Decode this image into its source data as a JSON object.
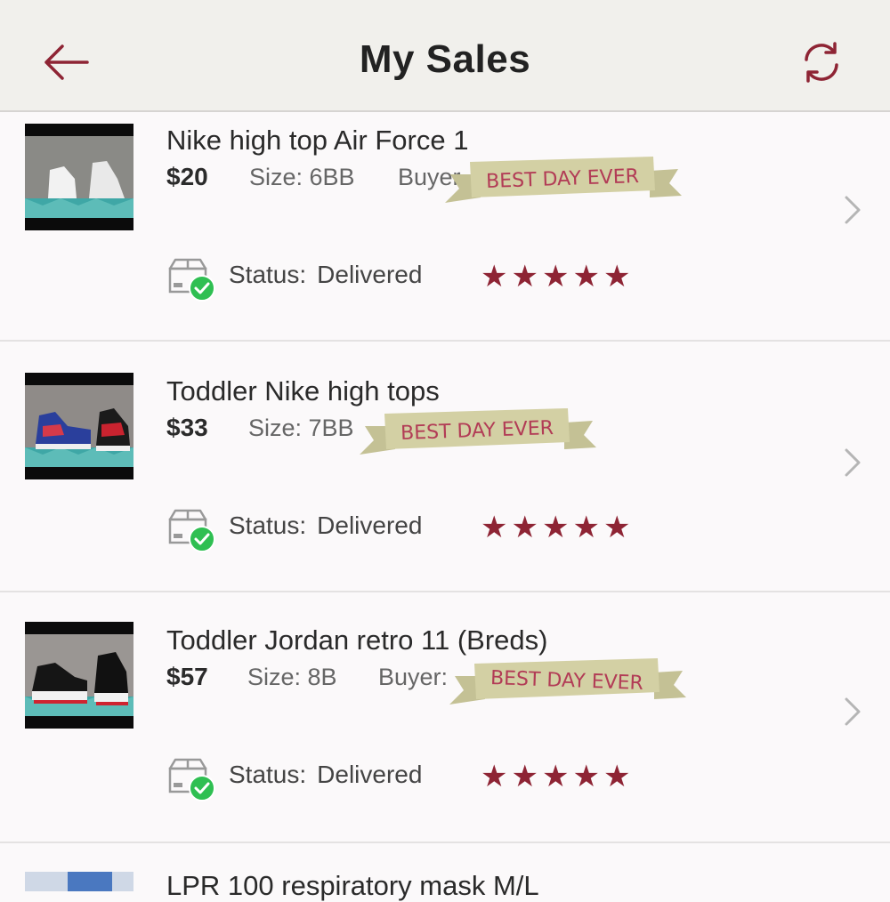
{
  "header": {
    "title": "My Sales",
    "back_icon": "arrow-left-icon",
    "refresh_icon": "refresh-icon"
  },
  "colors": {
    "accent": "#8e2434",
    "header_bg": "#f1f0ec",
    "status_check": "#2fbf52",
    "ribbon": "#d3d0a4"
  },
  "ribbon_text": "BEST DAY EVER",
  "sales": [
    {
      "title": "Nike high top Air Force 1",
      "price": "$20",
      "size": "Size: 6BB",
      "buyer": "Buyer",
      "status_label": "Status:",
      "status_value": "Delivered",
      "rating": 5
    },
    {
      "title": "Toddler Nike high tops",
      "price": "$33",
      "size": "Size: 7BB",
      "buyer": "",
      "status_label": "Status:",
      "status_value": "Delivered",
      "rating": 5
    },
    {
      "title": "Toddler Jordan retro 11 (Breds)",
      "price": "$57",
      "size": "Size: 8B",
      "buyer": "Buyer:",
      "status_label": "Status:",
      "status_value": "Delivered",
      "rating": 5
    },
    {
      "title": "LPR 100 respiratory mask M/L"
    }
  ]
}
